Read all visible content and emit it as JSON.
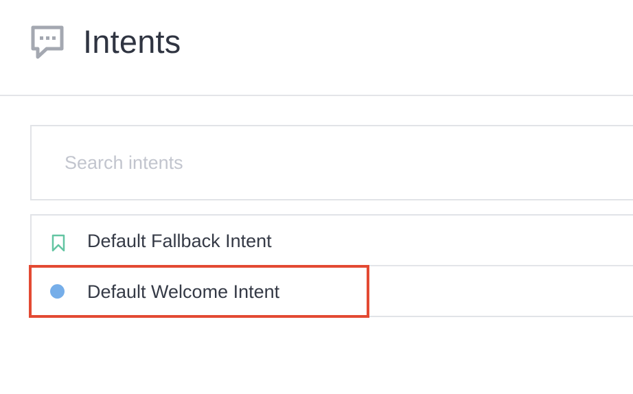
{
  "header": {
    "title": "Intents",
    "icon": "chat-bubble-icon"
  },
  "search": {
    "placeholder": "Search intents",
    "value": ""
  },
  "intents": [
    {
      "label": "Default Fallback Intent",
      "icon": "bookmark-icon",
      "icon_color": "#63c5a2"
    },
    {
      "label": "Default Welcome Intent",
      "icon": "dot-icon",
      "icon_color": "#76aee9",
      "highlighted": true
    }
  ],
  "colors": {
    "title": "#2f3441",
    "text": "#353a46",
    "placeholder": "#c2c5ce",
    "border": "#e1e3e7",
    "highlight": "#e34a33",
    "header_icon": "#a4a8b1"
  }
}
